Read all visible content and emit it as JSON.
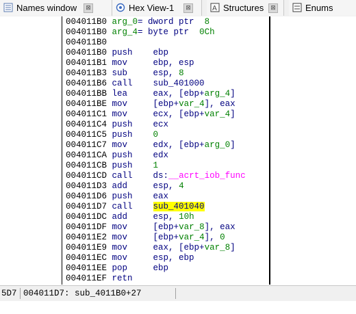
{
  "tabs": [
    {
      "label": "Names window",
      "icon": "names-icon",
      "close": "⊠"
    },
    {
      "label": "Hex View-1",
      "icon": "hex-view-icon",
      "close": "⊠"
    },
    {
      "label": "Structures",
      "icon": "structures-icon",
      "close": "⊠"
    },
    {
      "label": "Enums",
      "icon": "enums-icon",
      "close": ""
    }
  ],
  "lines": [
    {
      "addr": "004011B0",
      "pre": "",
      "mnem": "",
      "ops": [
        {
          "t": "arg_0",
          "c": "var"
        },
        {
          "t": "= dword ptr  ",
          "c": "ops"
        },
        {
          "t": "8",
          "c": "num"
        }
      ]
    },
    {
      "addr": "004011B0",
      "pre": "",
      "mnem": "",
      "ops": [
        {
          "t": "arg_4",
          "c": "var"
        },
        {
          "t": "= byte ptr  ",
          "c": "ops"
        },
        {
          "t": "0Ch",
          "c": "num"
        }
      ]
    },
    {
      "addr": "004011B0",
      "pre": "",
      "mnem": "",
      "ops": []
    },
    {
      "addr": "004011B0",
      "pre": "",
      "mnem": "push",
      "ops": [
        {
          "t": "ebp",
          "c": "ops"
        }
      ]
    },
    {
      "addr": "004011B1",
      "pre": "",
      "mnem": "mov",
      "ops": [
        {
          "t": "ebp, esp",
          "c": "ops"
        }
      ]
    },
    {
      "addr": "004011B3",
      "pre": "",
      "mnem": "sub",
      "ops": [
        {
          "t": "esp, ",
          "c": "ops"
        },
        {
          "t": "8",
          "c": "num"
        }
      ]
    },
    {
      "addr": "004011B6",
      "pre": "",
      "mnem": "call",
      "ops": [
        {
          "t": "sub_401000",
          "c": "ops"
        }
      ]
    },
    {
      "addr": "004011BB",
      "pre": "",
      "mnem": "lea",
      "ops": [
        {
          "t": "eax, [ebp+",
          "c": "ops"
        },
        {
          "t": "arg_4",
          "c": "var"
        },
        {
          "t": "]",
          "c": "ops"
        }
      ]
    },
    {
      "addr": "004011BE",
      "pre": "",
      "mnem": "mov",
      "ops": [
        {
          "t": "[ebp+",
          "c": "ops"
        },
        {
          "t": "var_4",
          "c": "var"
        },
        {
          "t": "], eax",
          "c": "ops"
        }
      ]
    },
    {
      "addr": "004011C1",
      "pre": "",
      "mnem": "mov",
      "ops": [
        {
          "t": "ecx, [ebp+",
          "c": "ops"
        },
        {
          "t": "var_4",
          "c": "var"
        },
        {
          "t": "]",
          "c": "ops"
        }
      ]
    },
    {
      "addr": "004011C4",
      "pre": "",
      "mnem": "push",
      "ops": [
        {
          "t": "ecx",
          "c": "ops"
        }
      ]
    },
    {
      "addr": "004011C5",
      "pre": "",
      "mnem": "push",
      "ops": [
        {
          "t": "0",
          "c": "num"
        }
      ]
    },
    {
      "addr": "004011C7",
      "pre": "",
      "mnem": "mov",
      "ops": [
        {
          "t": "edx, [ebp+",
          "c": "ops"
        },
        {
          "t": "arg_0",
          "c": "var"
        },
        {
          "t": "]",
          "c": "ops"
        }
      ]
    },
    {
      "addr": "004011CA",
      "pre": "",
      "mnem": "push",
      "ops": [
        {
          "t": "edx",
          "c": "ops"
        }
      ]
    },
    {
      "addr": "004011CB",
      "pre": "",
      "mnem": "push",
      "ops": [
        {
          "t": "1",
          "c": "num"
        }
      ]
    },
    {
      "addr": "004011CD",
      "pre": "",
      "mnem": "call",
      "ops": [
        {
          "t": "ds:",
          "c": "ops"
        },
        {
          "t": "__acrt_iob_func",
          "c": "func"
        }
      ]
    },
    {
      "addr": "004011D3",
      "pre": "",
      "mnem": "add",
      "ops": [
        {
          "t": "esp, ",
          "c": "ops"
        },
        {
          "t": "4",
          "c": "num"
        }
      ]
    },
    {
      "addr": "004011D6",
      "pre": "",
      "mnem": "push",
      "ops": [
        {
          "t": "eax",
          "c": "ops"
        }
      ]
    },
    {
      "addr": "004011D7",
      "pre": "",
      "mnem": "call",
      "ops": [
        {
          "t": "sub_401040",
          "c": "hl"
        }
      ]
    },
    {
      "addr": "004011DC",
      "pre": "",
      "mnem": "add",
      "ops": [
        {
          "t": "esp, ",
          "c": "ops"
        },
        {
          "t": "10h",
          "c": "num"
        }
      ]
    },
    {
      "addr": "004011DF",
      "pre": "",
      "mnem": "mov",
      "ops": [
        {
          "t": "[ebp+",
          "c": "ops"
        },
        {
          "t": "var_8",
          "c": "var"
        },
        {
          "t": "], eax",
          "c": "ops"
        }
      ]
    },
    {
      "addr": "004011E2",
      "pre": "",
      "mnem": "mov",
      "ops": [
        {
          "t": "[ebp+",
          "c": "ops"
        },
        {
          "t": "var_4",
          "c": "var"
        },
        {
          "t": "], ",
          "c": "ops"
        },
        {
          "t": "0",
          "c": "num"
        }
      ]
    },
    {
      "addr": "004011E9",
      "pre": "",
      "mnem": "mov",
      "ops": [
        {
          "t": "eax, [ebp+",
          "c": "ops"
        },
        {
          "t": "var_8",
          "c": "var"
        },
        {
          "t": "]",
          "c": "ops"
        }
      ]
    },
    {
      "addr": "004011EC",
      "pre": "",
      "mnem": "mov",
      "ops": [
        {
          "t": "esp, ebp",
          "c": "ops"
        }
      ]
    },
    {
      "addr": "004011EE",
      "pre": "",
      "mnem": "pop",
      "ops": [
        {
          "t": "ebp",
          "c": "ops"
        }
      ]
    },
    {
      "addr": "004011EF",
      "pre": "",
      "mnem": "retn",
      "ops": []
    }
  ],
  "status": {
    "offset": "5D7",
    "location": "004011D7: sub_4011B0+27"
  },
  "colors": {
    "mnemonic": "#000080",
    "number": "#008000",
    "variable": "#008000",
    "import_func": "#ff00ff",
    "highlight": "#ffff00"
  }
}
